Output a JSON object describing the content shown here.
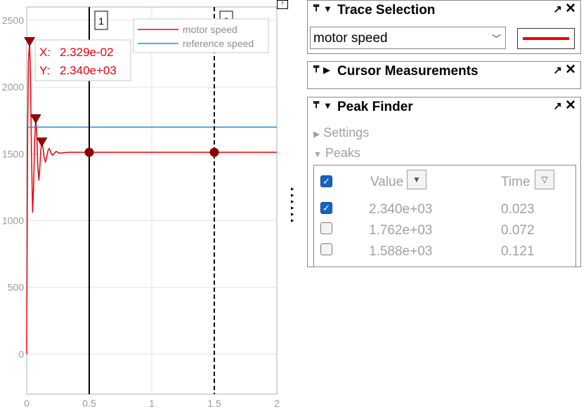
{
  "chart_data": {
    "type": "line",
    "xlim": [
      0,
      2
    ],
    "ylim": [
      -300,
      2600
    ],
    "x_ticks": [
      "0",
      "0.5",
      "1",
      "1.5",
      "2"
    ],
    "y_ticks": [
      "0",
      "500",
      "1000",
      "1500",
      "2000",
      "2500"
    ],
    "grid": true,
    "legend_position": "top-right",
    "series": [
      {
        "name": "motor speed",
        "color": "#e8000b",
        "points": [
          [
            0,
            0
          ],
          [
            0.003,
            700
          ],
          [
            0.008,
            1700
          ],
          [
            0.014,
            2200
          ],
          [
            0.023,
            2340
          ],
          [
            0.03,
            2100
          ],
          [
            0.038,
            1500
          ],
          [
            0.047,
            1060
          ],
          [
            0.055,
            1250
          ],
          [
            0.063,
            1580
          ],
          [
            0.072,
            1762
          ],
          [
            0.08,
            1660
          ],
          [
            0.088,
            1420
          ],
          [
            0.097,
            1300
          ],
          [
            0.105,
            1400
          ],
          [
            0.113,
            1530
          ],
          [
            0.121,
            1588
          ],
          [
            0.13,
            1550
          ],
          [
            0.14,
            1470
          ],
          [
            0.15,
            1440
          ],
          [
            0.16,
            1475
          ],
          [
            0.17,
            1525
          ],
          [
            0.18,
            1540
          ],
          [
            0.19,
            1520
          ],
          [
            0.2,
            1495
          ],
          [
            0.21,
            1490
          ],
          [
            0.22,
            1503
          ],
          [
            0.23,
            1515
          ],
          [
            0.24,
            1517
          ],
          [
            0.25,
            1510
          ],
          [
            0.27,
            1505
          ],
          [
            0.3,
            1510
          ],
          [
            0.35,
            1512
          ],
          [
            0.5,
            1512
          ],
          [
            1,
            1512
          ],
          [
            1.5,
            1512
          ],
          [
            2,
            1512
          ]
        ]
      },
      {
        "name": "reference speed",
        "color": "#1f8fe0",
        "points": [
          [
            0,
            1700
          ],
          [
            2,
            1700
          ]
        ]
      }
    ],
    "peak_markers": [
      {
        "x": 0.023,
        "y": 2340
      },
      {
        "x": 0.072,
        "y": 1762
      },
      {
        "x": 0.121,
        "y": 1588
      }
    ],
    "cursors": [
      {
        "label": "1",
        "x": 0.5,
        "y": 1512,
        "style": "solid"
      },
      {
        "label": "2",
        "x": 1.5,
        "y": 1512,
        "style": "dashed"
      }
    ],
    "datatip": {
      "x_label": "X:",
      "x_value": "2.329e-02",
      "y_label": "Y:",
      "y_value": "2.340e+03"
    }
  },
  "trace_selection": {
    "title": "Trace Selection",
    "selected": "motor speed",
    "line_color": "#e8000b"
  },
  "cursor_measurements": {
    "title": "Cursor Measurements"
  },
  "peak_finder": {
    "title": "Peak Finder",
    "settings_label": "Settings",
    "peaks_label": "Peaks",
    "col_value": "Value",
    "col_time": "Time",
    "rows": [
      {
        "checked": true,
        "value": "2.340e+03",
        "time": "0.023"
      },
      {
        "checked": false,
        "value": "1.762e+03",
        "time": "0.072"
      },
      {
        "checked": false,
        "value": "1.588e+03",
        "time": "0.121"
      }
    ]
  }
}
